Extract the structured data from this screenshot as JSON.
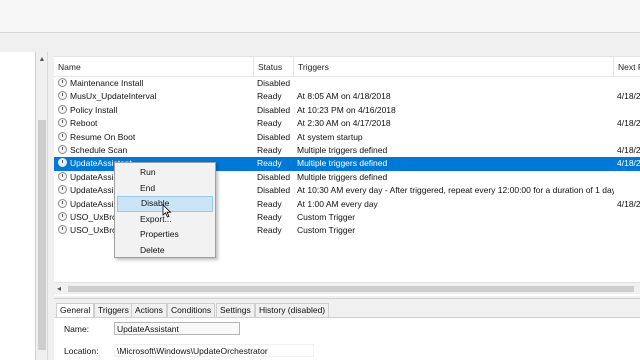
{
  "task_list": {
    "columns": [
      "Name",
      "Status",
      "Triggers",
      "Next R"
    ],
    "rows": [
      {
        "name": "Maintenance Install",
        "status": "Disabled",
        "triggers": "",
        "next": ""
      },
      {
        "name": "MusUx_UpdateInterval",
        "status": "Ready",
        "triggers": "At 8:05 AM on 4/18/2018",
        "next": "4/18/2"
      },
      {
        "name": "Policy Install",
        "status": "Disabled",
        "triggers": "At 10:23 PM on 4/16/2018",
        "next": ""
      },
      {
        "name": "Reboot",
        "status": "Ready",
        "triggers": "At 2:30 AM on 4/17/2018",
        "next": "4/18/2"
      },
      {
        "name": "Resume On Boot",
        "status": "Disabled",
        "triggers": "At system startup",
        "next": ""
      },
      {
        "name": "Schedule Scan",
        "status": "Ready",
        "triggers": "Multiple triggers defined",
        "next": "4/18/2"
      },
      {
        "name": "UpdateAssistant",
        "status": "Ready",
        "triggers": "Multiple triggers defined",
        "next": "4/18/2",
        "selected": true
      },
      {
        "name": "UpdateAssis",
        "status": "Disabled",
        "triggers": "Multiple triggers defined",
        "next": ""
      },
      {
        "name": "UpdateAssis",
        "status": "Disabled",
        "triggers": "At 10:30 AM every day - After triggered, repeat every 12:00:00 for a duration of 1 day.",
        "next": ""
      },
      {
        "name": "UpdateAssis",
        "status": "Ready",
        "triggers": "At 1:00 AM every day",
        "next": "4/18/2"
      },
      {
        "name": "USO_UxBrol",
        "status": "Ready",
        "triggers": "Custom Trigger",
        "next": ""
      },
      {
        "name": "USO_UxBrol",
        "status": "Ready",
        "triggers": "Custom Trigger",
        "next": ""
      }
    ]
  },
  "context_menu": {
    "items": [
      "Run",
      "End",
      "Disable",
      "Export...",
      "Properties",
      "Delete"
    ],
    "highlighted": "Disable"
  },
  "details": {
    "tabs": [
      "General",
      "Triggers",
      "Actions",
      "Conditions",
      "Settings",
      "History (disabled)"
    ],
    "active_tab": "General",
    "name_label": "Name:",
    "name_value": "UpdateAssistant",
    "location_label": "Location:",
    "location_value": "\\Microsoft\\Windows\\UpdateOrchestrator"
  },
  "colors": {
    "selection": "#0078d7",
    "menu_highlight": "#cce4f7"
  },
  "icons": {
    "task": "clock-icon",
    "cursor": "mouse-pointer-icon"
  }
}
